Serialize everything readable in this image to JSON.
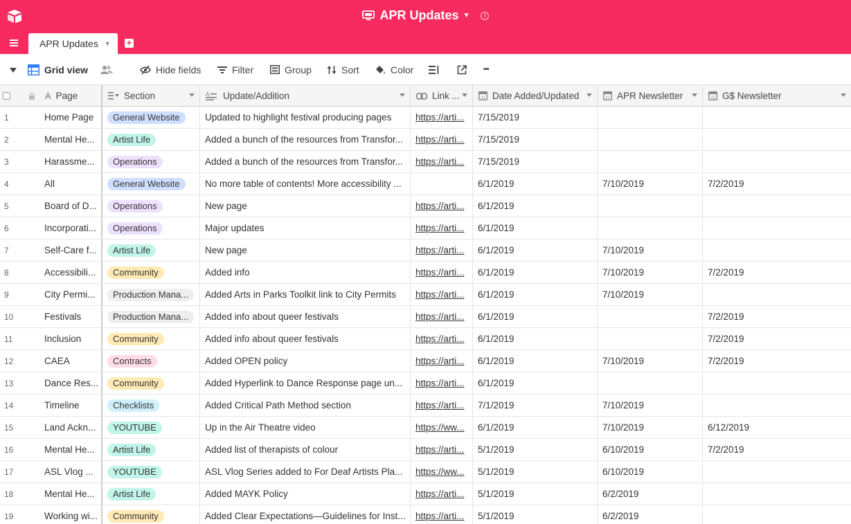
{
  "app": {
    "base_name": "APR Updates",
    "accent_color": "#f82b60"
  },
  "tabs": [
    {
      "label": "APR Updates"
    }
  ],
  "toolbar": {
    "view_name": "Grid view",
    "hide_fields": "Hide fields",
    "filter": "Filter",
    "group": "Group",
    "sort": "Sort",
    "color": "Color",
    "more": "•••"
  },
  "columns": [
    {
      "label": "Page",
      "icon": "text-field-icon"
    },
    {
      "label": "Section",
      "icon": "multiselect-icon"
    },
    {
      "label": "Update/Addition",
      "icon": "long-text-icon"
    },
    {
      "label": "Link ...",
      "icon": "url-icon"
    },
    {
      "label": "Date Added/Updated",
      "icon": "calendar-icon"
    },
    {
      "label": "APR Newsletter",
      "icon": "calendar-icon"
    },
    {
      "label": "G$ Newsletter",
      "icon": "calendar-icon"
    }
  ],
  "section_colors": {
    "General Website": "#cfdfff",
    "Artist Life": "#c2f5e9",
    "Operations": "#ede2fe",
    "Community": "#ffeab6",
    "Production Mana...": "#eeeeee",
    "Contracts": "#ffdce5",
    "Checklists": "#d0f0fd",
    "YOUTUBE": "#c2f5e9"
  },
  "rows": [
    {
      "num": "1",
      "page": "Home Page",
      "section": "General Website",
      "update": "Updated to highlight festival producing pages",
      "link": "https://arti...",
      "date": "7/15/2019",
      "apr": "",
      "gs": ""
    },
    {
      "num": "2",
      "page": "Mental He...",
      "section": "Artist Life",
      "update": "Added a bunch of the resources from Transfor...",
      "link": "https://arti...",
      "date": "7/15/2019",
      "apr": "",
      "gs": ""
    },
    {
      "num": "3",
      "page": "Harassme...",
      "section": "Operations",
      "update": "Added a bunch of the resources from Transfor...",
      "link": "https://arti...",
      "date": "7/15/2019",
      "apr": "",
      "gs": ""
    },
    {
      "num": "4",
      "page": "All",
      "section": "General Website",
      "update": "No more table of contents! More accessibility ...",
      "link": "",
      "date": "6/1/2019",
      "apr": "7/10/2019",
      "gs": "7/2/2019"
    },
    {
      "num": "5",
      "page": "Board of D...",
      "section": "Operations",
      "update": "New page",
      "link": "https://arti...",
      "date": "6/1/2019",
      "apr": "",
      "gs": ""
    },
    {
      "num": "6",
      "page": "Incorporati...",
      "section": "Operations",
      "update": "Major updates",
      "link": "https://arti...",
      "date": "6/1/2019",
      "apr": "",
      "gs": ""
    },
    {
      "num": "7",
      "page": "Self-Care f...",
      "section": "Artist Life",
      "update": "New page",
      "link": "https://arti...",
      "date": "6/1/2019",
      "apr": "7/10/2019",
      "gs": ""
    },
    {
      "num": "8",
      "page": "Accessibili...",
      "section": "Community",
      "update": "Added info",
      "link": "https://arti...",
      "date": "6/1/2019",
      "apr": "7/10/2019",
      "gs": "7/2/2019"
    },
    {
      "num": "9",
      "page": "City Permi...",
      "section": "Production Mana...",
      "update": "Added Arts in Parks Toolkit link to City Permits",
      "link": "https://arti...",
      "date": "6/1/2019",
      "apr": "7/10/2019",
      "gs": ""
    },
    {
      "num": "10",
      "page": "Festivals",
      "section": "Production Mana...",
      "update": "Added info about queer festivals",
      "link": "https://arti...",
      "date": "6/1/2019",
      "apr": "",
      "gs": "7/2/2019"
    },
    {
      "num": "11",
      "page": "Inclusion",
      "section": "Community",
      "update": "Added info about queer festivals",
      "link": "https://arti...",
      "date": "6/1/2019",
      "apr": "",
      "gs": "7/2/2019"
    },
    {
      "num": "12",
      "page": "CAEA",
      "section": "Contracts",
      "update": "Added OPEN policy",
      "link": "https://arti...",
      "date": "6/1/2019",
      "apr": "7/10/2019",
      "gs": "7/2/2019"
    },
    {
      "num": "13",
      "page": "Dance Res...",
      "section": "Community",
      "update": "Added Hyperlink to Dance Response page un...",
      "link": "https://arti...",
      "date": "6/1/2019",
      "apr": "",
      "gs": ""
    },
    {
      "num": "14",
      "page": "Timeline",
      "section": "Checklists",
      "update": "Added Critical Path Method section",
      "link": "https://arti...",
      "date": "7/1/2019",
      "apr": "7/10/2019",
      "gs": ""
    },
    {
      "num": "15",
      "page": "Land Ackn...",
      "section": "YOUTUBE",
      "update": "Up in the Air Theatre video",
      "link": "https://ww...",
      "date": "6/1/2019",
      "apr": "7/10/2019",
      "gs": "6/12/2019"
    },
    {
      "num": "16",
      "page": "Mental He...",
      "section": "Artist Life",
      "update": "Added list of therapists of colour",
      "link": "https://arti...",
      "date": "5/1/2019",
      "apr": "6/10/2019",
      "gs": "7/2/2019"
    },
    {
      "num": "17",
      "page": "ASL Vlog ...",
      "section": "YOUTUBE",
      "update": "ASL Vlog Series added to For Deaf Artists Pla...",
      "link": "https://ww...",
      "date": "5/1/2019",
      "apr": "6/10/2019",
      "gs": ""
    },
    {
      "num": "18",
      "page": "Mental He...",
      "section": "Artist Life",
      "update": "Added MAYK Policy",
      "link": "https://arti...",
      "date": "5/1/2019",
      "apr": "6/2/2019",
      "gs": ""
    },
    {
      "num": "19",
      "page": "Working wi...",
      "section": "Community",
      "update": "Added Clear Expectations—Guidelines for Inst...",
      "link": "https://arti...",
      "date": "5/1/2019",
      "apr": "6/2/2019",
      "gs": ""
    }
  ]
}
